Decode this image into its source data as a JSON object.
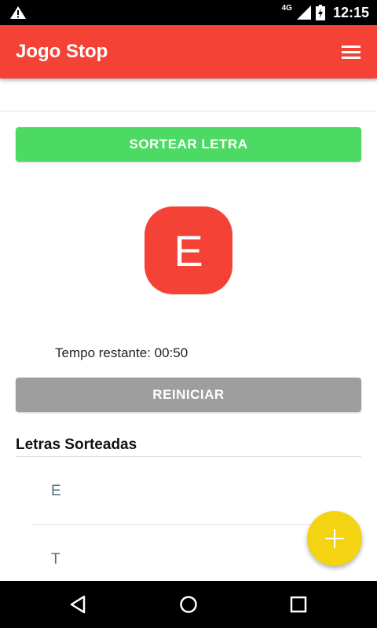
{
  "status_bar": {
    "network": "4G",
    "time": "12:15",
    "icons": [
      "warning-icon",
      "signal-icon",
      "battery-icon"
    ]
  },
  "app_bar": {
    "title": "Jogo Stop",
    "menu_icon": "hamburger-menu-icon",
    "color": "#f44336"
  },
  "actions": {
    "draw_label": "SORTEAR LETRA",
    "draw_color": "#4cd964",
    "reset_label": "REINICIAR",
    "reset_color": "#9e9e9e"
  },
  "current_letter": "E",
  "timer_text": "Tempo restante: 00:50",
  "drawn_letters": {
    "title": "Letras Sorteadas",
    "items": [
      "E",
      "T"
    ]
  },
  "fab": {
    "icon": "plus-icon",
    "color": "#f4d313"
  },
  "nav_bar": {
    "icons": [
      "back-icon",
      "home-icon",
      "recents-icon"
    ]
  }
}
